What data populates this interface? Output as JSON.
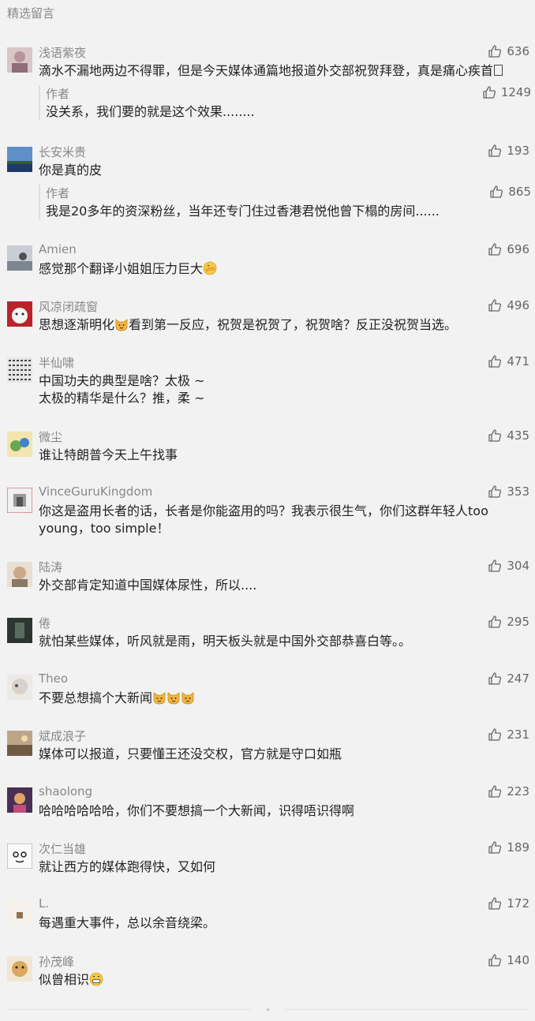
{
  "section_title": "精选留言",
  "like_icon": "thumbs-up-icon",
  "colors": {
    "background": "#f2f2f2",
    "meta_text": "#888888",
    "body_text": "#222222"
  },
  "comments": [
    {
      "name": "浅语紫夜",
      "likes": "636",
      "text": "滴水不漏地两边不得罪，但是今天媒体通篇地报道外交部祝贺拜登，真是痛心疾首",
      "reply": {
        "author": "作者",
        "likes": "1249",
        "text": "没关系，我们要的就是这个效果........"
      }
    },
    {
      "name": "长安米贵",
      "likes": "193",
      "text": "你是真的皮",
      "reply": {
        "author": "作者",
        "likes": "865",
        "text": "我是20多年的资深粉丝，当年还专门住过香港君悦他曾下榻的房间......"
      }
    },
    {
      "name": "Amien",
      "likes": "696",
      "text": "感觉那个翻译小姐姐压力巨大"
    },
    {
      "name": "风凉闭疏窗",
      "likes": "496",
      "text_a": "思想逐渐明化",
      "text_b": "看到第一反应，祝贺是祝贺了，祝贺啥？反正没祝贺当选。"
    },
    {
      "name": "半仙啸",
      "likes": "471",
      "text_line1": "中国功夫的典型是啥？太极 ~",
      "text_line2": "太极的精华是什么？推，柔 ~"
    },
    {
      "name": "微尘",
      "likes": "435",
      "text": "谁让特朗普今天上午找事"
    },
    {
      "name": "VinceGuruKingdom",
      "likes": "353",
      "text": "你这是盗用长者的话，长者是你能盗用的吗？我表示很生气，你们这群年轻人too young，too simple！"
    },
    {
      "name": "陆涛",
      "likes": "304",
      "text": "外交部肯定知道中国媒体尿性，所以...."
    },
    {
      "name": "倦",
      "likes": "295",
      "text": "就怕某些媒体，听风就是雨，明天板头就是中国外交部恭喜白等。。"
    },
    {
      "name": "Theo",
      "likes": "247",
      "text": "不要总想搞个大新闻"
    },
    {
      "name": "斌成浪子",
      "likes": "231",
      "text": "媒体可以报道，只要懂王还没交权，官方就是守口如瓶"
    },
    {
      "name": "shaolong",
      "likes": "223",
      "text": "哈哈哈哈哈哈，你们不要想搞一个大新闻，识得唔识得啊"
    },
    {
      "name": "次仁当雄",
      "likes": "189",
      "text": "就让西方的媒体跑得快，又如何"
    },
    {
      "name": "L.",
      "likes": "172",
      "text": "每遇重大事件，总以余音绕梁。"
    },
    {
      "name": "孙茂峰",
      "likes": "140",
      "text": "似曾相识"
    }
  ]
}
